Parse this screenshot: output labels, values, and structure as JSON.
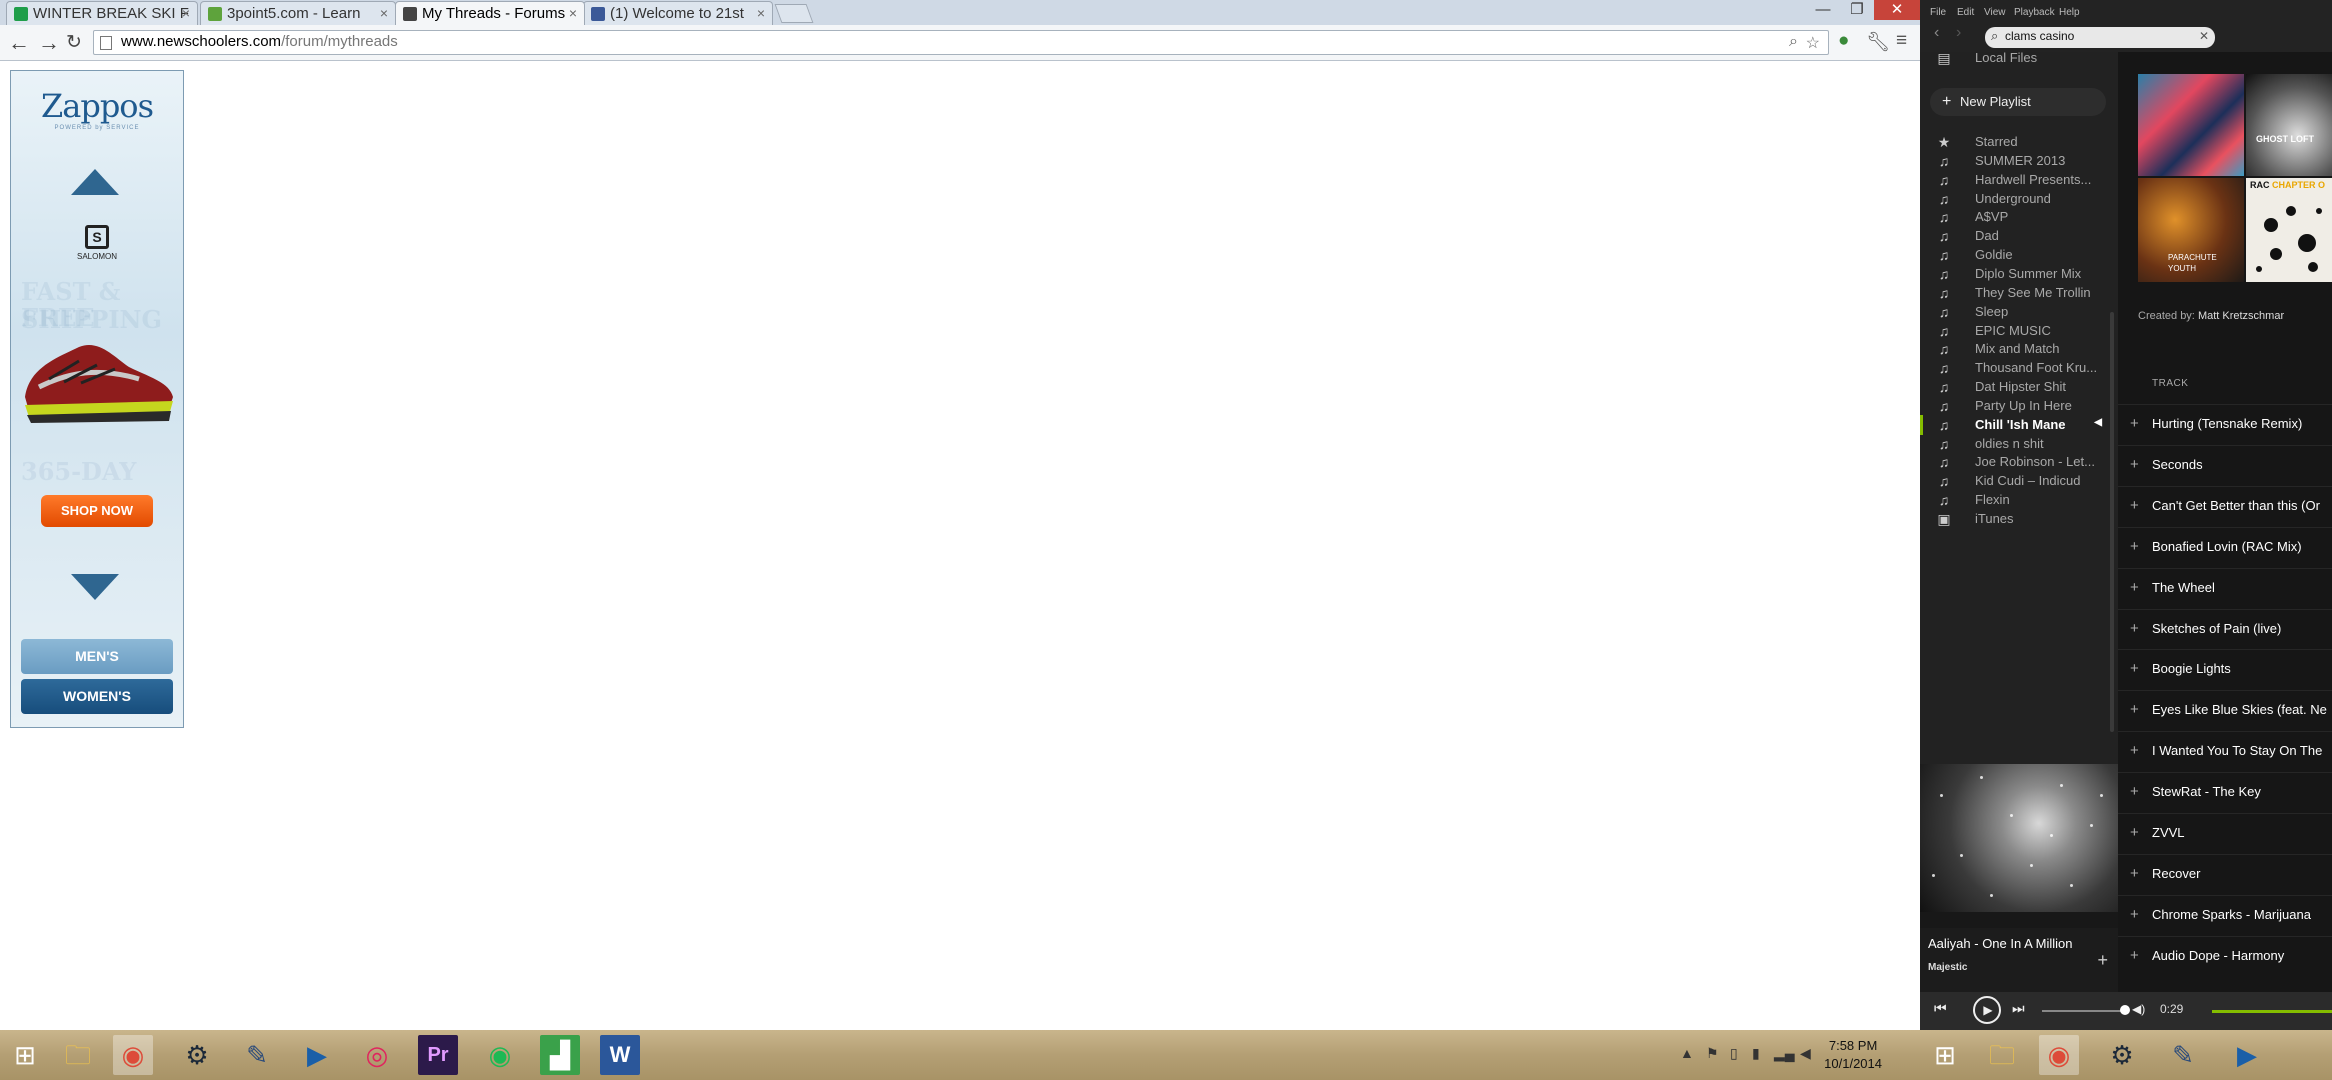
{
  "chrome": {
    "tabs": [
      {
        "title": "WINTER BREAK SKI F",
        "favicon_color": "#1f9e4a"
      },
      {
        "title": "3point5.com - Learn",
        "favicon_color": "#5ea33c"
      },
      {
        "title": "My Threads - Forums",
        "favicon_color": "#444444"
      },
      {
        "title": "(1) Welcome to 21st",
        "favicon_color": "#3b5998"
      }
    ],
    "active_tab": 2,
    "url_host": "www.newschoolers.com",
    "url_path": "/forum/mythreads"
  },
  "ad": {
    "logo": "Zappos",
    "logo_sub": "POWERED by SERVICE",
    "brand": "SALOMON",
    "ghost_lines": [
      "FAST & FREE",
      "SHIPPING",
      "365-DAY"
    ],
    "shop_now": "SHOP NOW",
    "mens": "MEN'S",
    "womens": "WOMEN'S"
  },
  "taskbar": {
    "time": "7:58 PM",
    "date": "10/1/2014"
  },
  "spotify": {
    "menu": [
      "File",
      "Edit",
      "View",
      "Playback",
      "Help"
    ],
    "search_value": "clams casino",
    "partial_item": "Local Files",
    "new_playlist": "New Playlist",
    "playlists": [
      {
        "label": "Starred",
        "icon": "star-icon"
      },
      {
        "label": "SUMMER 2013",
        "icon": "music-note-icon"
      },
      {
        "label": "Hardwell Presents...",
        "icon": "music-note-icon"
      },
      {
        "label": "Underground",
        "icon": "music-note-icon"
      },
      {
        "label": "A$VP",
        "icon": "music-note-icon"
      },
      {
        "label": "Dad",
        "icon": "music-note-icon"
      },
      {
        "label": "Goldie",
        "icon": "music-note-icon"
      },
      {
        "label": "Diplo Summer Mix",
        "icon": "music-note-icon"
      },
      {
        "label": "They See Me Trollin",
        "icon": "music-note-icon"
      },
      {
        "label": "Sleep",
        "icon": "music-note-icon"
      },
      {
        "label": "EPIC MUSIC",
        "icon": "music-note-icon"
      },
      {
        "label": "Mix and Match",
        "icon": "music-note-icon"
      },
      {
        "label": "Thousand Foot Kru...",
        "icon": "music-note-icon"
      },
      {
        "label": "Dat Hipster Shit",
        "icon": "music-note-icon"
      },
      {
        "label": "Party Up In Here",
        "icon": "music-note-icon"
      },
      {
        "label": "Chill 'Ish Mane",
        "icon": "music-note-icon"
      },
      {
        "label": "oldies n shit",
        "icon": "music-note-icon"
      },
      {
        "label": "Joe Robinson - Let...",
        "icon": "music-note-icon"
      },
      {
        "label": "Kid Cudi – Indicud",
        "icon": "music-note-icon"
      },
      {
        "label": "Flexin",
        "icon": "music-note-icon"
      },
      {
        "label": "iTunes",
        "icon": "itunes-icon"
      }
    ],
    "selected_playlist": 15,
    "cover": {
      "tile2": "GHOST LOFT",
      "tile3": "PARACHUTE YOUTH",
      "tile4_a": "RAC",
      "tile4_b": "CHAPTER O"
    },
    "created_by_label": "Created by:",
    "created_by_name": "Matt Kretzschmar",
    "track_header": "TRACK",
    "tracks": [
      "Hurting (Tensnake Remix)",
      "Seconds",
      "Can't Get Better than this (Or",
      "Bonafied Lovin (RAC Mix)",
      "The Wheel",
      "Sketches of Pain (live)",
      "Boogie Lights",
      "Eyes Like Blue Skies (feat. Ne",
      "I Wanted You To Stay On The",
      "StewRat - The Key",
      "ZVVL",
      "Recover",
      "Chrome Sparks - Marijuana",
      "Audio Dope - Harmony"
    ],
    "now_playing": {
      "title": "Aaliyah - One In A Million",
      "album": "Majestic"
    },
    "elapsed": "0:29",
    "colors": {
      "accent": "#84bd00",
      "background": "#181818"
    }
  }
}
